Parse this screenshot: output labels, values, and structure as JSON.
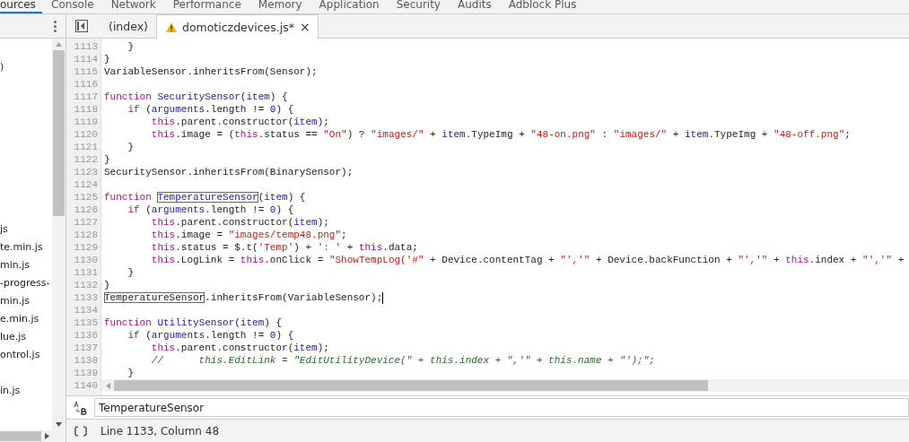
{
  "panel_tabs": [
    {
      "label": "ources",
      "selected": true
    },
    {
      "label": "Console",
      "selected": false
    },
    {
      "label": "Network",
      "selected": false
    },
    {
      "label": "Performance",
      "selected": false
    },
    {
      "label": "Memory",
      "selected": false
    },
    {
      "label": "Application",
      "selected": false
    },
    {
      "label": "Security",
      "selected": false
    },
    {
      "label": "Audits",
      "selected": false
    },
    {
      "label": "Adblock Plus",
      "selected": false
    }
  ],
  "sidebar": {
    "top_items": [
      ")"
    ],
    "items": [
      "js",
      "te.min.js",
      "min.js",
      "-progress-",
      "min.js",
      "e.min.js",
      "lue.js",
      "ontrol.js",
      "in.js"
    ]
  },
  "editor_tabs": [
    {
      "label": "(index)",
      "selected": false,
      "warning": false,
      "closable": false
    },
    {
      "label": "domoticzdevices.js*",
      "selected": true,
      "warning": true,
      "closable": true
    }
  ],
  "close_glyph": "×",
  "code_lines": [
    {
      "number": "1113",
      "tokens": [
        {
          "kind": "plain",
          "text": "    }"
        }
      ]
    },
    {
      "number": "1114",
      "tokens": [
        {
          "kind": "plain",
          "text": "}"
        }
      ]
    },
    {
      "number": "1115",
      "tokens": [
        {
          "kind": "plain",
          "text": "VariableSensor.inheritsFrom(Sensor);"
        }
      ]
    },
    {
      "number": "1116"
    },
    {
      "number": "1117",
      "tokens": [
        {
          "kind": "keyword",
          "text": "function "
        },
        {
          "kind": "def",
          "text": "SecuritySensor"
        },
        {
          "kind": "plain",
          "text": "("
        },
        {
          "kind": "variable",
          "text": "item"
        },
        {
          "kind": "plain",
          "text": ") {"
        }
      ]
    },
    {
      "number": "1118",
      "tokens": [
        {
          "kind": "keyword",
          "text": "    if"
        },
        {
          "kind": "plain",
          "text": " ("
        },
        {
          "kind": "variable",
          "text": "arguments"
        },
        {
          "kind": "plain",
          "text": ".length != "
        },
        {
          "kind": "number",
          "text": "0"
        },
        {
          "kind": "plain",
          "text": ") {"
        }
      ]
    },
    {
      "number": "1119",
      "tokens": [
        {
          "kind": "keyword",
          "text": "        this"
        },
        {
          "kind": "plain",
          "text": ".parent.constructor("
        },
        {
          "kind": "variable",
          "text": "item"
        },
        {
          "kind": "plain",
          "text": ");"
        }
      ]
    },
    {
      "number": "1120",
      "tokens": [
        {
          "kind": "keyword",
          "text": "        this"
        },
        {
          "kind": "plain",
          "text": ".image = ("
        },
        {
          "kind": "keyword",
          "text": "this"
        },
        {
          "kind": "plain",
          "text": ".status == "
        },
        {
          "kind": "string",
          "text": "\"On\""
        },
        {
          "kind": "plain",
          "text": ") ? "
        },
        {
          "kind": "string",
          "text": "\"images/\""
        },
        {
          "kind": "plain",
          "text": " + "
        },
        {
          "kind": "variable",
          "text": "item"
        },
        {
          "kind": "plain",
          "text": ".TypeImg + "
        },
        {
          "kind": "string",
          "text": "\"48-on.png\""
        },
        {
          "kind": "plain",
          "text": " : "
        },
        {
          "kind": "string",
          "text": "\"images/\""
        },
        {
          "kind": "plain",
          "text": " + "
        },
        {
          "kind": "variable",
          "text": "item"
        },
        {
          "kind": "plain",
          "text": ".TypeImg + "
        },
        {
          "kind": "string",
          "text": "\"48-off.png\""
        },
        {
          "kind": "plain",
          "text": ";"
        }
      ]
    },
    {
      "number": "1121",
      "tokens": [
        {
          "kind": "plain",
          "text": "    }"
        }
      ]
    },
    {
      "number": "1122",
      "tokens": [
        {
          "kind": "plain",
          "text": "}"
        }
      ]
    },
    {
      "number": "1123",
      "tokens": [
        {
          "kind": "plain",
          "text": "SecuritySensor.inheritsFrom(BinarySensor);"
        }
      ]
    },
    {
      "number": "1124"
    },
    {
      "number": "1125",
      "tokens": [
        {
          "kind": "keyword",
          "text": "function "
        },
        {
          "kind": "defmatch",
          "text": "TemperatureSensor"
        },
        {
          "kind": "plain",
          "text": "("
        },
        {
          "kind": "variable",
          "text": "item"
        },
        {
          "kind": "plain",
          "text": ") {"
        }
      ]
    },
    {
      "number": "1126",
      "tokens": [
        {
          "kind": "keyword",
          "text": "    if"
        },
        {
          "kind": "plain",
          "text": " ("
        },
        {
          "kind": "variable",
          "text": "arguments"
        },
        {
          "kind": "plain",
          "text": ".length != "
        },
        {
          "kind": "number",
          "text": "0"
        },
        {
          "kind": "plain",
          "text": ") {"
        }
      ]
    },
    {
      "number": "1127",
      "tokens": [
        {
          "kind": "keyword",
          "text": "        this"
        },
        {
          "kind": "plain",
          "text": ".parent.constructor("
        },
        {
          "kind": "variable",
          "text": "item"
        },
        {
          "kind": "plain",
          "text": ");"
        }
      ]
    },
    {
      "number": "1128",
      "tokens": [
        {
          "kind": "keyword",
          "text": "        this"
        },
        {
          "kind": "plain",
          "text": ".image = "
        },
        {
          "kind": "string",
          "text": "\"images/temp48.png\""
        },
        {
          "kind": "plain",
          "text": ";"
        }
      ]
    },
    {
      "number": "1129",
      "tokens": [
        {
          "kind": "keyword",
          "text": "        this"
        },
        {
          "kind": "plain",
          "text": ".status = $.t("
        },
        {
          "kind": "string",
          "text": "'Temp'"
        },
        {
          "kind": "plain",
          "text": ") + "
        },
        {
          "kind": "string",
          "text": "': '"
        },
        {
          "kind": "plain",
          "text": " + "
        },
        {
          "kind": "keyword",
          "text": "this"
        },
        {
          "kind": "plain",
          "text": ".data;"
        }
      ]
    },
    {
      "number": "1130",
      "tokens": [
        {
          "kind": "keyword",
          "text": "        this"
        },
        {
          "kind": "plain",
          "text": ".LogLink = "
        },
        {
          "kind": "keyword",
          "text": "this"
        },
        {
          "kind": "plain",
          "text": ".onClick = "
        },
        {
          "kind": "string",
          "text": "\"ShowTempLog('#\""
        },
        {
          "kind": "plain",
          "text": " + Device.contentTag + "
        },
        {
          "kind": "string",
          "text": "\"','\""
        },
        {
          "kind": "plain",
          "text": " + Device.backFunction + "
        },
        {
          "kind": "string",
          "text": "\"','\""
        },
        {
          "kind": "plain",
          "text": " + "
        },
        {
          "kind": "keyword",
          "text": "this"
        },
        {
          "kind": "plain",
          "text": ".index + "
        },
        {
          "kind": "string",
          "text": "\"','\""
        },
        {
          "kind": "plain",
          "text": " +"
        }
      ]
    },
    {
      "number": "1131",
      "tokens": [
        {
          "kind": "plain",
          "text": "    }"
        }
      ]
    },
    {
      "number": "1132",
      "tokens": [
        {
          "kind": "plain",
          "text": "}"
        }
      ]
    },
    {
      "number": "1133",
      "tokens": [
        {
          "kind": "match",
          "text": "TemperatureSensor"
        },
        {
          "kind": "plain",
          "text": ".inheritsFrom(VariableSensor);"
        },
        {
          "kind": "cursor"
        }
      ]
    },
    {
      "number": "1134"
    },
    {
      "number": "1135",
      "tokens": [
        {
          "kind": "keyword",
          "text": "function "
        },
        {
          "kind": "def",
          "text": "UtilitySensor"
        },
        {
          "kind": "plain",
          "text": "("
        },
        {
          "kind": "variable",
          "text": "item"
        },
        {
          "kind": "plain",
          "text": ") {"
        }
      ]
    },
    {
      "number": "1136",
      "tokens": [
        {
          "kind": "keyword",
          "text": "    if"
        },
        {
          "kind": "plain",
          "text": " ("
        },
        {
          "kind": "variable",
          "text": "arguments"
        },
        {
          "kind": "plain",
          "text": ".length != "
        },
        {
          "kind": "number",
          "text": "0"
        },
        {
          "kind": "plain",
          "text": ") {"
        }
      ]
    },
    {
      "number": "1137",
      "tokens": [
        {
          "kind": "keyword",
          "text": "        this"
        },
        {
          "kind": "plain",
          "text": ".parent.constructor("
        },
        {
          "kind": "variable",
          "text": "item"
        },
        {
          "kind": "plain",
          "text": ");"
        }
      ]
    },
    {
      "number": "1138",
      "tokens": [
        {
          "kind": "comment",
          "text": "        //      this.EditLink = \"EditUtilityDevice(\" + this.index + \",'\" + this.name + \"');\";"
        }
      ]
    },
    {
      "number": "1139",
      "tokens": [
        {
          "kind": "plain",
          "text": "    }"
        }
      ]
    },
    {
      "number": "1140"
    }
  ],
  "search": {
    "value": "TemperatureSensor"
  },
  "status_bar": {
    "position": "Line 1133, Column 48"
  }
}
